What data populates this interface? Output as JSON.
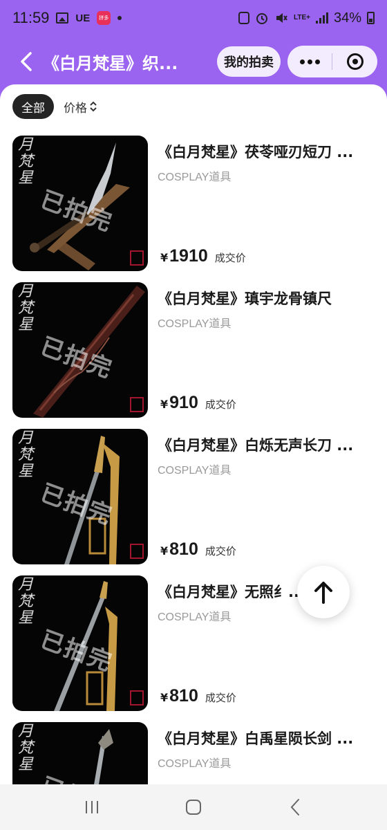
{
  "status_bar": {
    "time": "11:59",
    "carrier_tag": "UE",
    "app_badge": "拼多",
    "network": "LTE+",
    "battery": "34%"
  },
  "nav": {
    "title": "《白月梵星》织...",
    "my_auction_label": "我的拍卖"
  },
  "filters": {
    "all_label": "全部",
    "price_label": "价格"
  },
  "thumbnail": {
    "logo_text": "月梵星",
    "watermark": "已拍完"
  },
  "items": [
    {
      "title": "《白月梵星》茯苓哑刃短刀 ...",
      "category": "COSPLAY道具",
      "currency": "¥",
      "price": "1910",
      "price_label": "成交价"
    },
    {
      "title": "《白月梵星》瑱宇龙骨镇尺",
      "category": "COSPLAY道具",
      "currency": "¥",
      "price": "910",
      "price_label": "成交价"
    },
    {
      "title": "《白月梵星》白烁无声长刀 ...",
      "category": "COSPLAY道具",
      "currency": "¥",
      "price": "810",
      "price_label": "成交价"
    },
    {
      "title": "《白月梵星》无照纟...",
      "category": "COSPLAY道具",
      "currency": "¥",
      "price": "810",
      "price_label": "成交价"
    },
    {
      "title": "《白月梵星》白禹星陨长剑 ...",
      "category": "COSPLAY道具",
      "currency": "¥",
      "price": "",
      "price_label": ""
    }
  ],
  "colors": {
    "header_purple": "#9a63f0",
    "chip_dark": "#242424",
    "muted_text": "#999999"
  }
}
